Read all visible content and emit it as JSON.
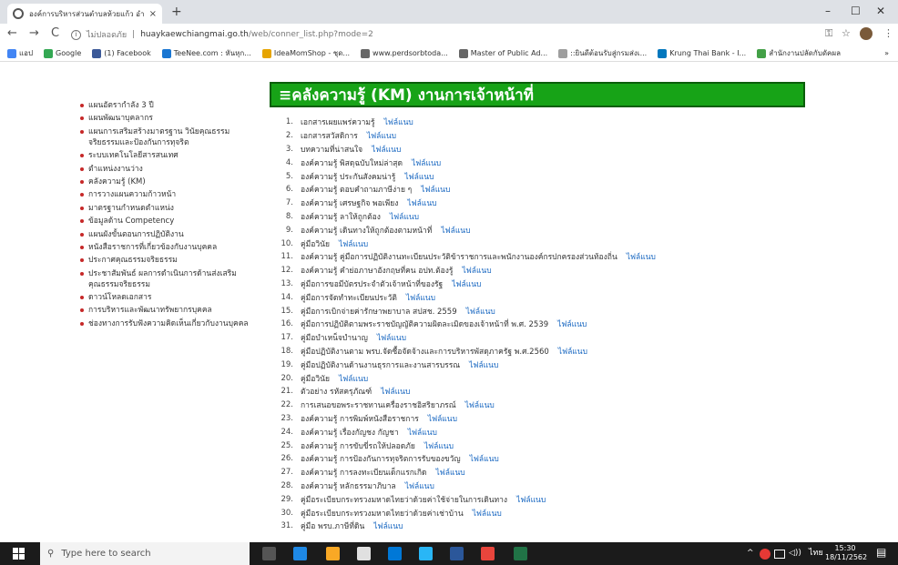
{
  "browser": {
    "tab_title": "องค์การบริหารส่วนตำบลห้วยแก้ว อำเภ",
    "tab_close": "×",
    "new_tab": "+",
    "nav_back": "←",
    "nav_forward": "→",
    "nav_reload": "C",
    "security_text": "ไม่ปลอดภัย",
    "separator": "|",
    "url_host": "huaykaewchiangmai.go.th",
    "url_path": "/web/conner_list.php?mode=2",
    "win_min": "–",
    "win_max": "☐",
    "win_close": "✕",
    "key_icon": "⚿",
    "star_icon": "☆",
    "menu_icon": "⋮"
  },
  "bookmarks": [
    {
      "label": "แอป",
      "color": "#4285f4"
    },
    {
      "label": "Google",
      "color": "#34a853"
    },
    {
      "label": "(1) Facebook",
      "color": "#3b5998"
    },
    {
      "label": "TeeNee.com : หันหุก...",
      "color": "#1976d2"
    },
    {
      "label": "IdeaMomShop - ชุด...",
      "color": "#e6a400"
    },
    {
      "label": "www.perdsorbtoda...",
      "color": "#666666"
    },
    {
      "label": "Master of Public Ad...",
      "color": "#666666"
    },
    {
      "label": "::ยินดีต้อนรับสู่กรมส่งเ...",
      "color": "#9e9e9e"
    },
    {
      "label": "Krung Thai Bank - I...",
      "color": "#0277bd"
    },
    {
      "label": "สำนักงานปลัดกับดัคผล",
      "color": "#43a047"
    }
  ],
  "bookmarks_more": "»",
  "sidebar": {
    "items": [
      "แผนอัตรากำลัง 3 ปี",
      "แผนพัฒนาบุคลากร",
      "แผนการเสริมสร้างมาตรฐาน วินัยคุณธรรม จริยธรรมและป้องกันการทุจริต",
      "ระบบเทคโนโลยีสารสนเทศ",
      "ตำแหน่งงานว่าง",
      "คลังความรู้ (KM)",
      "การวางแผนความก้าวหน้า",
      "มาตรฐานกำหนดตำแหน่ง",
      "ข้อมูลด้าน Competency",
      "แผนผังขั้นตอนการปฏิบัติงาน",
      "หนังสือราชการที่เกี่ยวข้องกับงานบุคคล",
      "ประกาศคุณธรรมจริยธรรม",
      "ประชาสัมพันธ์ ผลการดำเนินการด้านส่งเสริม คุณธรรมจริยธรรม",
      "ดาวน์โหลดเอกสาร",
      "การบริหารและพัฒนาทรัพยากรบุคคล",
      "ช่องทางการรับฟังความคิดเห็นเกี่ยวกับงานบุคคล"
    ]
  },
  "page": {
    "title": "≡คลังความรู้ (KM) งานการเจ้าหน้าที่",
    "attachment_label": "ไฟล์แนบ"
  },
  "km_list": [
    {
      "num": "1.",
      "title": "เอกสารเผยแพร่ความรู้"
    },
    {
      "num": "2.",
      "title": "เอกสารสวัสดิการ"
    },
    {
      "num": "3.",
      "title": "บทความที่น่าสนใจ"
    },
    {
      "num": "4.",
      "title": "องค์ความรู้ พิสดุฉบับใหม่ล่าสุด"
    },
    {
      "num": "5.",
      "title": "องค์ความรู้ ประกันสังคมน่ารู้"
    },
    {
      "num": "6.",
      "title": "องค์ความรู้ ตอบคำถามภาษีง่าย ๆ"
    },
    {
      "num": "7.",
      "title": "องค์ความรู้ เศรษฐกิจ พอเพียง"
    },
    {
      "num": "8.",
      "title": "องค์ความรู้ ลาให้ถูกต้อง"
    },
    {
      "num": "9.",
      "title": "องค์ความรู้ เดินทางให้ถูกต้องตามหน้าที่"
    },
    {
      "num": "10.",
      "title": "คู่มือวินัย"
    },
    {
      "num": "11.",
      "title": "องค์ความรู้ คู่มือการปฏิบัติงานทะเบียนประวัติข้าราชการและพนักงานองค์กรปกครองส่วนท้องถิ่น"
    },
    {
      "num": "12.",
      "title": "องค์ความรู้ คำย่อภาษาอังกฤษที่คน อปท.ต้องรู้"
    },
    {
      "num": "13.",
      "title": "คู่มือการขอมีบัตรประจำตัวเจ้าหน้าที่ของรัฐ"
    },
    {
      "num": "14.",
      "title": "คู่มือการจัดทำทะเบียนประวัติ"
    },
    {
      "num": "15.",
      "title": "คู่มือการเบิกจ่ายค่ารักษาพยาบาล สปสช. 2559"
    },
    {
      "num": "16.",
      "title": "คู่มือการปฏิบัติตามพระราชบัญญัติความผิดละเมิดของเจ้าหน้าที่ พ.ศ. 2539"
    },
    {
      "num": "17.",
      "title": "คู่มือบำเหน็จบำนาญ"
    },
    {
      "num": "18.",
      "title": "คู่มือปฏิบัติงานตาม พรบ.จัดซื้อจัดจ้างและการบริหารพัสดุภาครัฐ พ.ศ.2560"
    },
    {
      "num": "19.",
      "title": "คู่มือปฏิบัติงานด้านงานธุรการและงานสารบรรณ"
    },
    {
      "num": "20.",
      "title": "คู่มือวินัย"
    },
    {
      "num": "21.",
      "title": "ตัวอย่าง รหัสครุภัณฑ์"
    },
    {
      "num": "22.",
      "title": "การเสนอขอพระราชทานเครื่องราชอิสริยาภรณ์"
    },
    {
      "num": "23.",
      "title": "องค์ความรู้ การพิมพ์หนังสือราชการ"
    },
    {
      "num": "24.",
      "title": "องค์ความรู้ เรื่องกัญชง กัญชา"
    },
    {
      "num": "25.",
      "title": "องค์ความรู้ การขับขี่รถให้ปลอดภัย"
    },
    {
      "num": "26.",
      "title": "องค์ความรู้ การป้องกันการทุจริตการรับของขวัญ"
    },
    {
      "num": "27.",
      "title": "องค์ความรู้ การลงทะเบียนเด็กแรกเกิด"
    },
    {
      "num": "28.",
      "title": "องค์ความรู้ หลักธรรมาภิบาล"
    },
    {
      "num": "29.",
      "title": "คู่มือระเบียบกระทรวงมหาดไทยว่าด้วยค่าใช้จ่ายในการเดินทาง"
    },
    {
      "num": "30.",
      "title": "คู่มือระเบียบกระทรวงมหาดไทยว่าด้วยค่าเช่าบ้าน"
    },
    {
      "num": "31.",
      "title": "คู่มือ พรบ.ภาษีที่ดิน"
    }
  ],
  "taskbar": {
    "search_placeholder": "Type here to search",
    "tray_up": "^",
    "speaker": "◁))",
    "language": "ไทย",
    "time": "15:30",
    "date": "18/11/2562",
    "notification": "▤",
    "apps": [
      {
        "name": "task-view",
        "color": "#555555"
      },
      {
        "name": "blue-app",
        "color": "#1e88e5"
      },
      {
        "name": "store",
        "color": "#f9a825"
      },
      {
        "name": "mail",
        "color": "#e0e0e0"
      },
      {
        "name": "edge",
        "color": "#0078d7"
      },
      {
        "name": "explorer",
        "color": "#29b6f6"
      },
      {
        "name": "word",
        "color": "#2b579a"
      },
      {
        "name": "chrome",
        "color": "#e8453c"
      },
      {
        "name": "excel",
        "color": "#217346"
      }
    ]
  }
}
